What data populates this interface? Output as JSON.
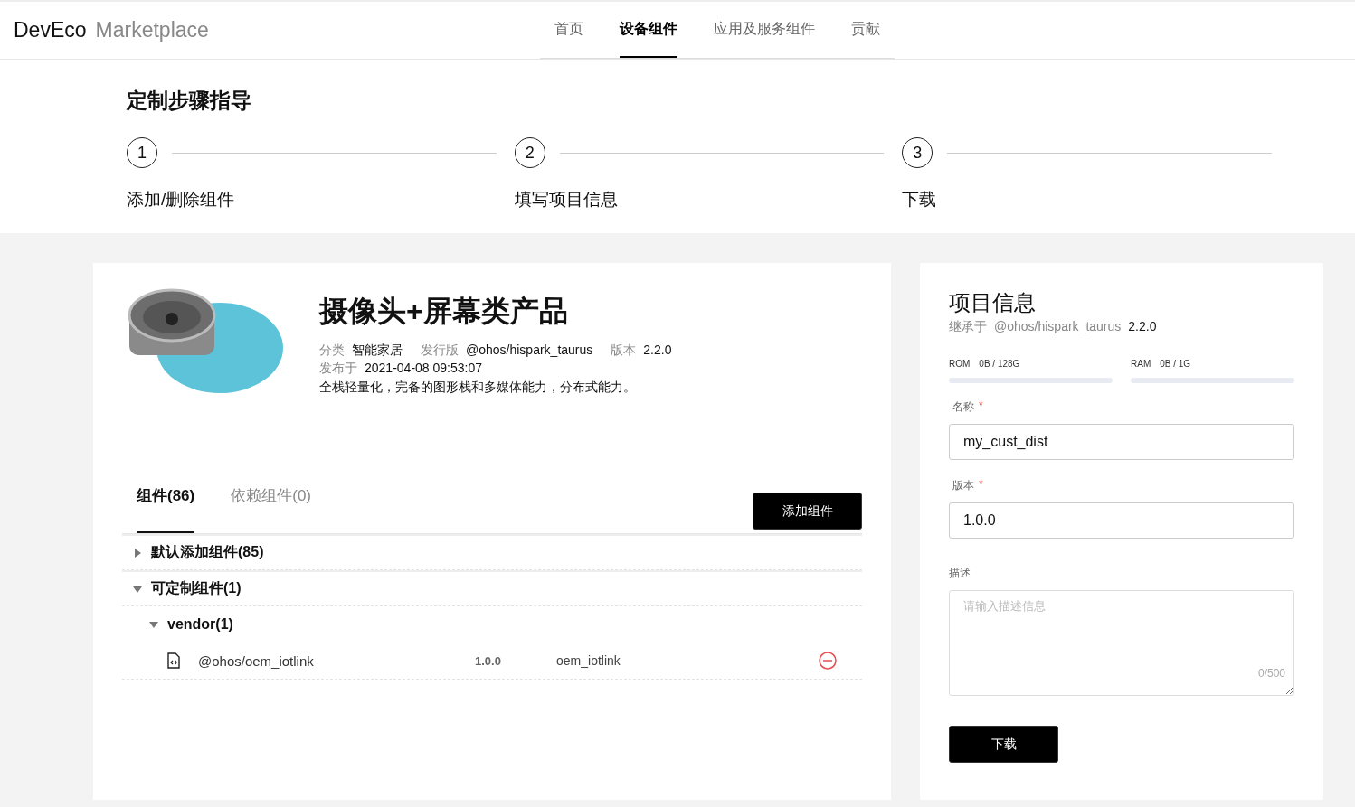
{
  "brand": {
    "name": "DevEco",
    "suffix": "Marketplace"
  },
  "nav": [
    {
      "label": "首页",
      "selected": false
    },
    {
      "label": "设备组件",
      "selected": true
    },
    {
      "label": "应用及服务组件",
      "selected": false
    },
    {
      "label": "贡献",
      "selected": false
    }
  ],
  "guide": {
    "title": "定制步骤指导",
    "steps": [
      {
        "number": "1",
        "label": "添加/删除组件"
      },
      {
        "number": "2",
        "label": "填写项目信息"
      },
      {
        "number": "3",
        "label": "下载"
      }
    ]
  },
  "product": {
    "title": "摄像头+屏幕类产品",
    "meta_rows": [
      [
        {
          "label": "分类",
          "value": "智能家居"
        },
        {
          "label": "发行版",
          "value": "@ohos/hispark_taurus"
        },
        {
          "label": "版本",
          "value": "2.2.0"
        }
      ],
      [
        {
          "label": "发布于",
          "value": "2021-04-08 09:53:07"
        }
      ]
    ],
    "description": "全栈轻量化，完备的图形栈和多媒体能力，分布式能力。"
  },
  "tabs": [
    {
      "label": "组件(86)",
      "selected": true
    },
    {
      "label": "依赖组件(0)",
      "selected": false
    }
  ],
  "add_button": "添加组件",
  "tree": [
    {
      "kind": "group",
      "label": "默认添加组件(85)",
      "expanded": false
    },
    {
      "kind": "group",
      "label": "可定制组件(1)",
      "expanded": true,
      "children": [
        {
          "kind": "group",
          "label": "vendor(1)",
          "expanded": true,
          "children": [
            {
              "kind": "component",
              "name": "@ohos/oem_iotlink",
              "version": "1.0.0",
              "module": "oem_iotlink"
            }
          ]
        }
      ]
    }
  ],
  "project": {
    "title": "项目信息",
    "inherit": {
      "label": "继承于",
      "value": "@ohos/hispark_taurus",
      "version": "2.2.0"
    },
    "meters": [
      {
        "label": "ROM",
        "reading": "0B / 128G",
        "level": 0
      },
      {
        "label": "RAM",
        "reading": "0B / 1G",
        "level": 0
      }
    ],
    "name_field": {
      "label": "名称",
      "required_mark": "*",
      "value": "my_cust_dist"
    },
    "version_field": {
      "label": "版本",
      "required_mark": "*",
      "value": "1.0.0"
    },
    "description_field": {
      "label": "描述",
      "placeholder": "请输入描述信息",
      "counter": "0/500"
    },
    "download_button": "下载"
  }
}
